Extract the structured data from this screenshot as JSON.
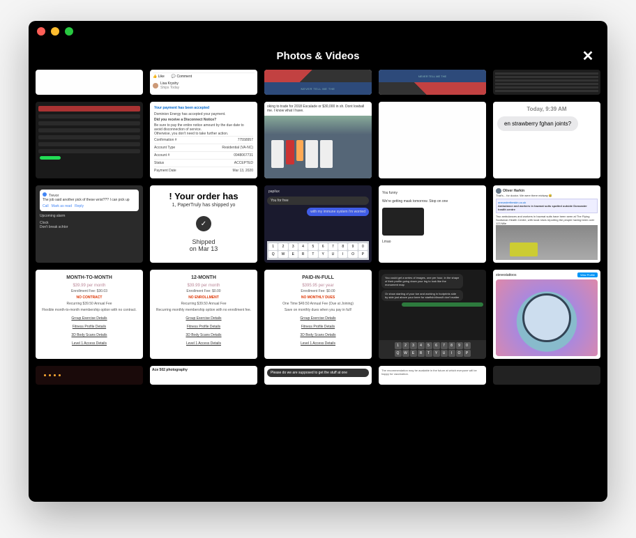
{
  "window": {
    "title": "Photos & Videos"
  },
  "keyboard": {
    "numbers": [
      "1",
      "2",
      "3",
      "4",
      "5",
      "6",
      "7",
      "8",
      "9",
      "0"
    ],
    "qwerty": [
      "Q",
      "W",
      "E",
      "R",
      "T",
      "Y",
      "U",
      "I",
      "O",
      "P"
    ]
  },
  "thumbs": {
    "r1c2": {
      "like": "Like",
      "comment": "Comment",
      "user": "Lisa Kryshy",
      "usersub": "Ships Today"
    },
    "r1c3": {
      "text": "NEVER TELL ME THE"
    },
    "r1c4": {
      "text": "NEVER TELL ME THE"
    },
    "r2c2": {
      "title": "Your payment has been accepted",
      "subtitle": "Dominion Energy has accepted your payment.",
      "bold": "Did you receive a Disconnect Notice?",
      "note1": "Be sure to pay the entire notice amount by the due date to avoid disconnection of service.",
      "note2": "Otherwise, you don't need to take further action.",
      "kv": [
        {
          "k": "Confirmation #",
          "v": "77558957"
        },
        {
          "k": "Account Type",
          "v": "Residential (VA-NC)"
        },
        {
          "k": "Account #",
          "v": "0948067731"
        },
        {
          "k": "Status",
          "v": "ACCEPTED"
        },
        {
          "k": "Payment Date",
          "v": "Mar 13, 2020"
        }
      ]
    },
    "r2c3": {
      "head": "oking to trade for 2018 Escalade or $30,000 in sh. Dont lowball me. I know what I have."
    },
    "r2c5": {
      "time": "Today, 9:39 AM",
      "msg": "en strawberry fghan joints?"
    },
    "r3c1": {
      "sender": "Trevor",
      "body": "The job said another pick of these wrist??? I can pick up",
      "link_call": "Call",
      "link_mark": "Mark as read",
      "link_reply": "Reply",
      "upcoming": "Upcoming alarm",
      "clock": "Clock",
      "dont": "Don't break schtor"
    },
    "r3c2": {
      "big": "! Your order has",
      "sub": "1, PaperTruly has shipped yo",
      "status": "Shipped",
      "date": "on Mar 13"
    },
    "r3c3": {
      "name": "papilux",
      "msg1": "You for free",
      "msg2": "with my immune system i'm worried"
    },
    "r3c4": {
      "msg1": "You funny",
      "msg2": "We're getting mask tomorrow. Stop on one",
      "msg3": "Lmao"
    },
    "r3c5": {
      "name": "Oliver Harkin",
      "text": "That's... for doctor. We were there midway 😅",
      "link": "oneundertheskin.co.uk",
      "linktext": "Ambulance and workers in hazmat suits spotted outside Doncaster health centre",
      "body": "Two ambulances and workers in hazmat suits have been seen at The Flying Scotsman Health Centre, with local news reporting the people having been over 123 Mile"
    },
    "r4c1": {
      "plan": "MONTH-TO-MONTH",
      "price": "$39.99 per month",
      "enroll": "Enrollment Fee: $30.03",
      "noc": "NO CONTRACT",
      "recurring": "Recurring $39.50 Annual Fee",
      "desc": "Flexible month-to-month membership option with no contract.",
      "items": [
        "Group Exercise Details",
        "Fitness Profile Details",
        "3D Body Scans Details",
        "Level 1 Access Details"
      ]
    },
    "r4c2": {
      "plan": "12-MONTH",
      "price": "$39.99 per month",
      "enroll": "Enrollment Fee: $0.00",
      "noc": "NO ENROLLMENT",
      "recurring": "Recurring $39.50 Annual Fee",
      "desc": "Recurring monthly membership option with no enrollment fee.",
      "items": [
        "Group Exercise Details",
        "Fitness Profile Details",
        "3D Body Scans Details",
        "Level 1 Access Details"
      ]
    },
    "r4c3": {
      "plan": "PAID-IN-FULL",
      "price": "$395.95 per year",
      "enroll": "Enrollment Fee: $0.00",
      "noc": "NO MONTHLY DUES",
      "recurring": "One Time $49.50 Annual Fee (Due at Joining)",
      "desc": "Save on monthly dues when you pay in full!",
      "items": [
        "Group Exercise Details",
        "Fitness Profile Details",
        "3D Body Scans Details",
        "Level 1 Access Details"
      ]
    },
    "r4c4": {
      "msg1": "You could get a series of images, one per hour, in the shape of their profile going down your leg to look like the monument map",
      "msg2": "Or show starting of your toe and working in footprints side by side just above your knee for starfish/dinos/it don't matter"
    },
    "r4c5": {
      "user": "stevestattoos",
      "btn": "View Profile"
    },
    "r5c2": {
      "name": "Ace 502 photography"
    },
    "r5c3": {
      "msg": "Please do we are supposed to get the stuff at one"
    },
    "r5c4": {
      "text": "The recommendation may be available in the future at which everyone will be happy for vaccination."
    }
  }
}
